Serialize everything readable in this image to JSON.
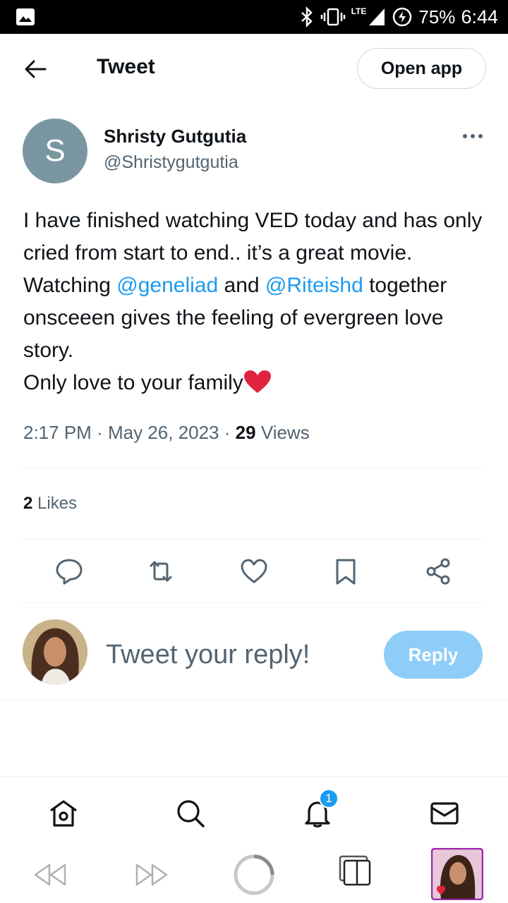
{
  "status_bar": {
    "lte": "LTE",
    "battery": "75%",
    "time": "6:44"
  },
  "header": {
    "title": "Tweet",
    "open_app_label": "Open app"
  },
  "author": {
    "initial": "S",
    "name": "Shristy Gutgutia",
    "handle": "@Shristygutgutia"
  },
  "tweet": {
    "line1": "I have finished watching VED today and has only cried from start to end.. it’s a great movie. Watching ",
    "mention1": "@geneliad",
    "and": " and ",
    "mention2": "@Riteishd",
    "line2": " together onsceeen gives the feeling of evergreen love story.",
    "line3": "Only love to your family",
    "time": "2:17 PM",
    "date": "May 26, 2023",
    "views_count": "29",
    "views_label": "Views",
    "likes_count": "2",
    "likes_label": "Likes"
  },
  "reply": {
    "placeholder": "Tweet your reply!",
    "button_label": "Reply"
  },
  "bottom_nav": {
    "notification_count": "1"
  },
  "colors": {
    "accent": "#1d9bf0",
    "reply_button": "#8ecdf8",
    "avatar_bg": "#7a96a1",
    "secondary_text": "#536471"
  }
}
